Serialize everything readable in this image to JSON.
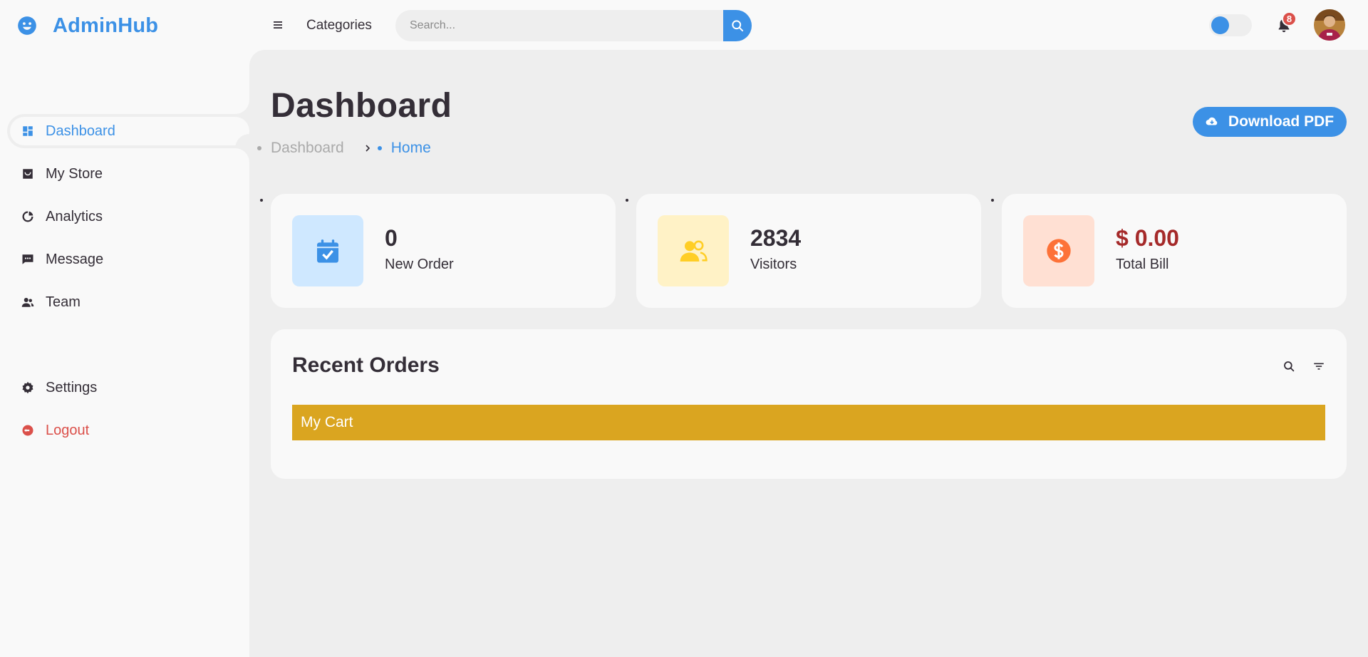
{
  "brand": {
    "name": "AdminHub"
  },
  "sidebar": {
    "items": [
      {
        "label": "Dashboard",
        "icon": "dashboard-icon",
        "active": true
      },
      {
        "label": "My Store",
        "icon": "store-icon"
      },
      {
        "label": "Analytics",
        "icon": "analytics-icon"
      },
      {
        "label": "Message",
        "icon": "message-icon"
      },
      {
        "label": "Team",
        "icon": "team-icon"
      }
    ],
    "bottom_items": [
      {
        "label": "Settings",
        "icon": "gear-icon"
      },
      {
        "label": "Logout",
        "icon": "logout-icon"
      }
    ]
  },
  "nav": {
    "categories_label": "Categories",
    "search_placeholder": "Search...",
    "notification_count": "8",
    "theme_switch": "off"
  },
  "main": {
    "title": "Dashboard",
    "breadcrumb": [
      "Dashboard",
      "Home"
    ],
    "download_label": "Download PDF",
    "stats": [
      {
        "value": "0",
        "label": "New Order",
        "icon": "calendar-check-icon",
        "tile_color": "#cfe8ff",
        "icon_color": "#3c91e6"
      },
      {
        "value": "2834",
        "label": "Visitors",
        "icon": "group-icon",
        "tile_color": "#fff2c6",
        "icon_color": "#ffce26"
      },
      {
        "value": "$ 0.00",
        "label": "Total Bill",
        "icon": "dollar-circle-icon",
        "tile_color": "#ffe0d3",
        "icon_color": "#fd7238",
        "value_color": "#a52a2a"
      }
    ],
    "recent_orders": {
      "title": "Recent Orders",
      "cart_label": "My Cart"
    }
  },
  "colors": {
    "accent": "#3c91e6",
    "logout": "#db504a",
    "cart_bar": "#daa520",
    "main_bg": "#eeeeee",
    "panel_bg": "#f9f9f9"
  }
}
